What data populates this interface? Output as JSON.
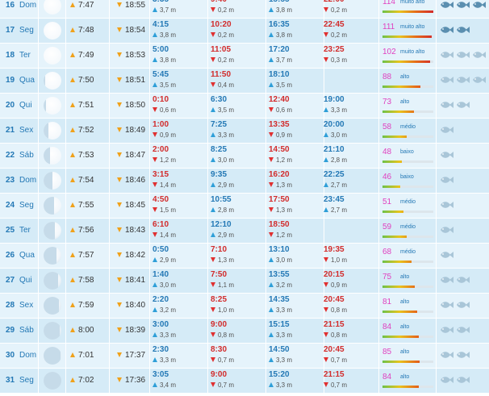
{
  "colors": {
    "row_even": "#e5f3fb",
    "row_odd": "#d5ebf7",
    "high_tide_time": "#2378b5",
    "low_tide_time": "#d22b2b",
    "coefficient_value": "#e040c0",
    "sun_arrow": "#f0a11a",
    "fish_active": "#5b8fb0",
    "fish_inactive": "#a9c6d8"
  },
  "days": [
    {
      "day": "16",
      "weekday": "Dom",
      "moon": 0.99,
      "sunrise": "7:47",
      "sunset": "18:55",
      "tides": [
        {
          "type": "high",
          "time": "3:35",
          "height": "3,7 m"
        },
        {
          "type": "low",
          "time": "9:40",
          "height": "0,2 m"
        },
        {
          "type": "high",
          "time": "15:55",
          "height": "3,8 m"
        },
        {
          "type": "low",
          "time": "22:00",
          "height": "0,2 m"
        }
      ],
      "coefficient": "114",
      "coef_label": "muito alto",
      "coef_level": 1.0,
      "fish": [
        3,
        3,
        3
      ]
    },
    {
      "day": "17",
      "weekday": "Seg",
      "moon": 1.0,
      "sunrise": "7:48",
      "sunset": "18:54",
      "tides": [
        {
          "type": "high",
          "time": "4:15",
          "height": "3,8 m"
        },
        {
          "type": "low",
          "time": "10:20",
          "height": "0,2 m"
        },
        {
          "type": "high",
          "time": "16:35",
          "height": "3,8 m"
        },
        {
          "type": "low",
          "time": "22:45",
          "height": "0,2 m"
        }
      ],
      "coefficient": "111",
      "coef_label": "muito alto",
      "coef_level": 0.97,
      "fish": [
        3,
        3
      ]
    },
    {
      "day": "18",
      "weekday": "Ter",
      "moon": 0.98,
      "sunrise": "7:49",
      "sunset": "18:53",
      "tides": [
        {
          "type": "high",
          "time": "5:00",
          "height": "3,8 m"
        },
        {
          "type": "low",
          "time": "11:05",
          "height": "0,2 m"
        },
        {
          "type": "high",
          "time": "17:20",
          "height": "3,7 m"
        },
        {
          "type": "low",
          "time": "23:25",
          "height": "0,3 m"
        }
      ],
      "coefficient": "102",
      "coef_label": "muito alto",
      "coef_level": 0.93,
      "fish": [
        1,
        1,
        1
      ]
    },
    {
      "day": "19",
      "weekday": "Qua",
      "moon": 0.93,
      "sunrise": "7:50",
      "sunset": "18:51",
      "tides": [
        {
          "type": "high",
          "time": "5:45",
          "height": "3,5 m"
        },
        {
          "type": "low",
          "time": "11:50",
          "height": "0,4 m"
        },
        {
          "type": "high",
          "time": "18:10",
          "height": "3,5 m"
        },
        {
          "type": "empty",
          "time": "",
          "height": ""
        }
      ],
      "coefficient": "88",
      "coef_label": "alto",
      "coef_level": 0.75,
      "fish": [
        1,
        1,
        1
      ]
    },
    {
      "day": "20",
      "weekday": "Qui",
      "moon": 0.85,
      "sunrise": "7:51",
      "sunset": "18:50",
      "tides": [
        {
          "type": "low",
          "time": "0:10",
          "height": "0,6 m"
        },
        {
          "type": "high",
          "time": "6:30",
          "height": "3,5 m"
        },
        {
          "type": "low",
          "time": "12:40",
          "height": "0,6 m"
        },
        {
          "type": "high",
          "time": "19:00",
          "height": "3,3 m"
        }
      ],
      "coefficient": "73",
      "coef_label": "alto",
      "coef_level": 0.62,
      "fish": [
        1,
        1
      ]
    },
    {
      "day": "21",
      "weekday": "Sex",
      "moon": 0.72,
      "sunrise": "7:52",
      "sunset": "18:49",
      "tides": [
        {
          "type": "low",
          "time": "1:00",
          "height": "0,9 m"
        },
        {
          "type": "high",
          "time": "7:25",
          "height": "3,3 m"
        },
        {
          "type": "low",
          "time": "13:35",
          "height": "0,9 m"
        },
        {
          "type": "high",
          "time": "20:00",
          "height": "3,0 m"
        }
      ],
      "coefficient": "58",
      "coef_label": "médio",
      "coef_level": 0.48,
      "fish": [
        1
      ]
    },
    {
      "day": "22",
      "weekday": "Sáb",
      "moon": 0.62,
      "sunrise": "7:53",
      "sunset": "18:47",
      "tides": [
        {
          "type": "low",
          "time": "2:00",
          "height": "1,2 m"
        },
        {
          "type": "high",
          "time": "8:25",
          "height": "3,0 m"
        },
        {
          "type": "low",
          "time": "14:50",
          "height": "1,2 m"
        },
        {
          "type": "high",
          "time": "21:10",
          "height": "2,8 m"
        }
      ],
      "coefficient": "48",
      "coef_label": "baixo",
      "coef_level": 0.38,
      "fish": [
        1
      ]
    },
    {
      "day": "23",
      "weekday": "Dom",
      "moon": 0.52,
      "sunrise": "7:54",
      "sunset": "18:46",
      "tides": [
        {
          "type": "low",
          "time": "3:15",
          "height": "1,4 m"
        },
        {
          "type": "high",
          "time": "9:35",
          "height": "2,9 m"
        },
        {
          "type": "low",
          "time": "16:20",
          "height": "1,3 m"
        },
        {
          "type": "high",
          "time": "22:25",
          "height": "2,7 m"
        }
      ],
      "coefficient": "46",
      "coef_label": "baixo",
      "coef_level": 0.35,
      "fish": [
        1
      ]
    },
    {
      "day": "24",
      "weekday": "Seg",
      "moon": 0.42,
      "sunrise": "7:55",
      "sunset": "18:45",
      "tides": [
        {
          "type": "low",
          "time": "4:50",
          "height": "1,5 m"
        },
        {
          "type": "high",
          "time": "10:55",
          "height": "2,8 m"
        },
        {
          "type": "low",
          "time": "17:50",
          "height": "1,3 m"
        },
        {
          "type": "high",
          "time": "23:45",
          "height": "2,7 m"
        }
      ],
      "coefficient": "51",
      "coef_label": "médio",
      "coef_level": 0.41,
      "fish": [
        1
      ]
    },
    {
      "day": "25",
      "weekday": "Ter",
      "moon": 0.35,
      "sunrise": "7:56",
      "sunset": "18:43",
      "tides": [
        {
          "type": "low",
          "time": "6:10",
          "height": "1,4 m"
        },
        {
          "type": "high",
          "time": "12:10",
          "height": "2,9 m"
        },
        {
          "type": "low",
          "time": "18:50",
          "height": "1,2 m"
        },
        {
          "type": "empty",
          "time": "",
          "height": ""
        }
      ],
      "coefficient": "59",
      "coef_label": "médio",
      "coef_level": 0.48,
      "fish": [
        1
      ]
    },
    {
      "day": "26",
      "weekday": "Qua",
      "moon": 0.27,
      "sunrise": "7:57",
      "sunset": "18:42",
      "tides": [
        {
          "type": "high",
          "time": "0:50",
          "height": "2,9 m"
        },
        {
          "type": "low",
          "time": "7:10",
          "height": "1,3 m"
        },
        {
          "type": "high",
          "time": "13:10",
          "height": "3,0 m"
        },
        {
          "type": "low",
          "time": "19:35",
          "height": "1,0 m"
        }
      ],
      "coefficient": "68",
      "coef_label": "médio",
      "coef_level": 0.57,
      "fish": [
        1
      ]
    },
    {
      "day": "27",
      "weekday": "Qui",
      "moon": 0.18,
      "sunrise": "7:58",
      "sunset": "18:41",
      "tides": [
        {
          "type": "high",
          "time": "1:40",
          "height": "3,0 m"
        },
        {
          "type": "low",
          "time": "7:50",
          "height": "1,1 m"
        },
        {
          "type": "high",
          "time": "13:55",
          "height": "3,2 m"
        },
        {
          "type": "low",
          "time": "20:15",
          "height": "0,9 m"
        }
      ],
      "coefficient": "75",
      "coef_label": "alto",
      "coef_level": 0.63,
      "fish": [
        1,
        1
      ]
    },
    {
      "day": "28",
      "weekday": "Sex",
      "moon": 0.12,
      "sunrise": "7:59",
      "sunset": "18:40",
      "tides": [
        {
          "type": "high",
          "time": "2:20",
          "height": "3,2 m"
        },
        {
          "type": "low",
          "time": "8:25",
          "height": "1,0 m"
        },
        {
          "type": "high",
          "time": "14:35",
          "height": "3,3 m"
        },
        {
          "type": "low",
          "time": "20:45",
          "height": "0,8 m"
        }
      ],
      "coefficient": "81",
      "coef_label": "alto",
      "coef_level": 0.69,
      "fish": [
        1,
        1
      ]
    },
    {
      "day": "29",
      "weekday": "Sáb",
      "moon": 0.07,
      "sunrise": "8:00",
      "sunset": "18:39",
      "tides": [
        {
          "type": "high",
          "time": "3:00",
          "height": "3,3 m"
        },
        {
          "type": "low",
          "time": "9:00",
          "height": "0,8 m"
        },
        {
          "type": "high",
          "time": "15:15",
          "height": "3,3 m"
        },
        {
          "type": "low",
          "time": "21:15",
          "height": "0,8 m"
        }
      ],
      "coefficient": "84",
      "coef_label": "alto",
      "coef_level": 0.72,
      "fish": [
        1,
        1
      ]
    },
    {
      "day": "30",
      "weekday": "Dom",
      "moon": 0.03,
      "sunrise": "7:01",
      "sunset": "17:37",
      "tides": [
        {
          "type": "high",
          "time": "2:30",
          "height": "3,3 m"
        },
        {
          "type": "low",
          "time": "8:30",
          "height": "0,7 m"
        },
        {
          "type": "high",
          "time": "14:50",
          "height": "3,3 m"
        },
        {
          "type": "low",
          "time": "20:45",
          "height": "0,7 m"
        }
      ],
      "coefficient": "85",
      "coef_label": "alto",
      "coef_level": 0.73,
      "fish": [
        1,
        1
      ]
    },
    {
      "day": "31",
      "weekday": "Seg",
      "moon": 0.01,
      "sunrise": "7:02",
      "sunset": "17:36",
      "tides": [
        {
          "type": "high",
          "time": "3:05",
          "height": "3,4 m"
        },
        {
          "type": "low",
          "time": "9:00",
          "height": "0,7 m"
        },
        {
          "type": "high",
          "time": "15:20",
          "height": "3,3 m"
        },
        {
          "type": "low",
          "time": "21:15",
          "height": "0,7 m"
        }
      ],
      "coefficient": "84",
      "coef_label": "alto",
      "coef_level": 0.72,
      "fish": [
        1,
        1
      ]
    }
  ]
}
